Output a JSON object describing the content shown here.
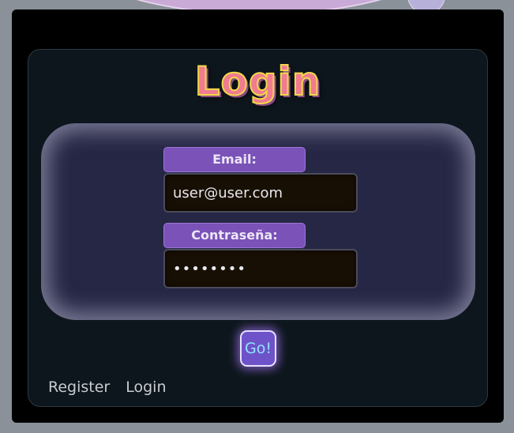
{
  "login": {
    "title": "Login",
    "email": {
      "label": "Email:",
      "value": "user@user.com"
    },
    "password": {
      "label": "Contraseña:",
      "value": "12345678"
    },
    "submit_label": "Go!"
  },
  "nav": {
    "links": [
      {
        "label": "Register"
      },
      {
        "label": "Login"
      }
    ]
  },
  "colors": {
    "page_background": "#8a9199",
    "card_background": "#0d161c",
    "panel_background": "#262745",
    "label_background": "#7a52b8",
    "title_fill": "#f07c8f",
    "title_outline": "#f3d84a",
    "button_background": "#6e52c9"
  }
}
